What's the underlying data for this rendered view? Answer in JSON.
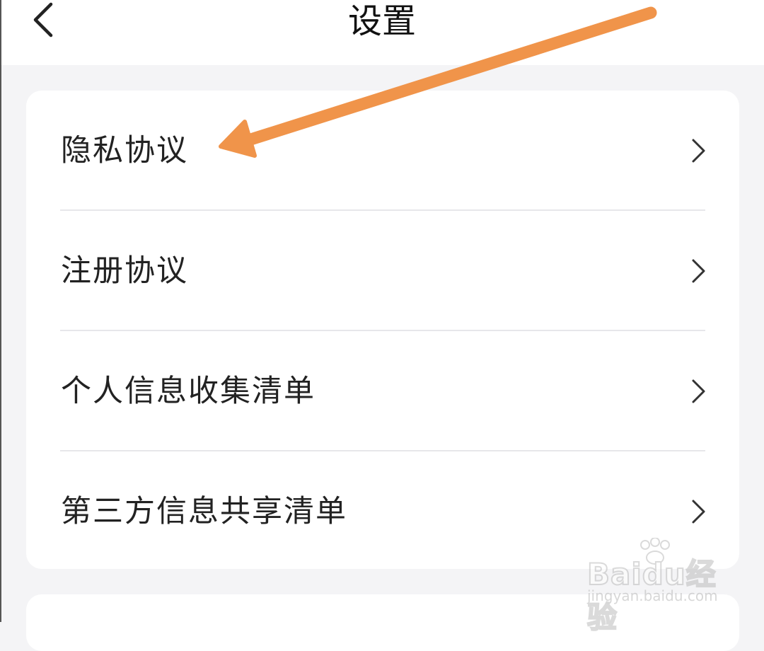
{
  "header": {
    "title": "设置",
    "back_icon": "chevron-left-icon"
  },
  "settings_list": {
    "items": [
      {
        "label": "隐私协议",
        "icon": "chevron-right-icon"
      },
      {
        "label": "注册协议",
        "icon": "chevron-right-icon"
      },
      {
        "label": "个人信息收集清单",
        "icon": "chevron-right-icon"
      },
      {
        "label": "第三方信息共享清单",
        "icon": "chevron-right-icon"
      }
    ]
  },
  "annotation": {
    "arrow_color": "#f0944a",
    "arrow_target": "隐私协议"
  },
  "watermark": {
    "logo": "Baidu经验",
    "url": "jingyan.baidu.com"
  },
  "colors": {
    "background": "#f4f4f6",
    "card": "#ffffff",
    "text": "#222222",
    "divider": "#e7e7ea",
    "accent_arrow": "#f0944a"
  }
}
